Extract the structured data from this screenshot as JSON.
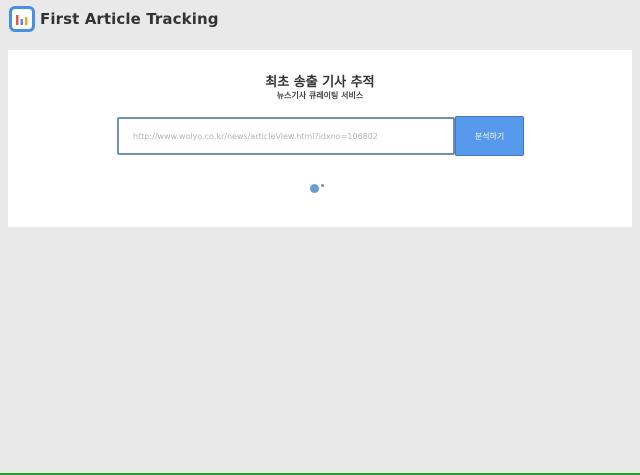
{
  "app": {
    "title": "First Article Tracking",
    "logo_icon": "bar-chart-icon"
  },
  "main": {
    "title": "최초 송출 기사 추적",
    "subtitle": "뉴스기사 큐레이팅 서비스",
    "url_input": {
      "placeholder": "http://www.wolyo.co.kr/news/articleView.html?idxno=106802",
      "value": ""
    },
    "analyze_button_label": "분석하기",
    "loading_icon": "loading-spinner-icon"
  },
  "colors": {
    "background": "#e9e9e9",
    "card": "#ffffff",
    "accent": "#5799ec",
    "logo": "#4a90e2"
  }
}
